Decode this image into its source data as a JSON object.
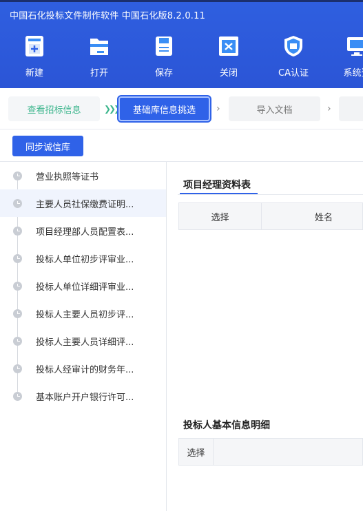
{
  "app": {
    "title": "中国石化投标文件制作软件 中国石化版8.2.0.11"
  },
  "toolbar": {
    "new": {
      "label": "新建",
      "icon": "new-file-icon"
    },
    "open": {
      "label": "打开",
      "icon": "open-folder-icon"
    },
    "save": {
      "label": "保存",
      "icon": "save-disk-icon"
    },
    "close": {
      "label": "关闭",
      "icon": "close-window-icon"
    },
    "ca": {
      "label": "CA认证",
      "icon": "shield-icon"
    },
    "system": {
      "label": "系统登",
      "icon": "monitor-icon"
    }
  },
  "steps": [
    {
      "label": "查看招标信息",
      "state": "done"
    },
    {
      "label": "基础库信息挑选",
      "state": "active"
    },
    {
      "label": "导入文档",
      "state": "pending"
    },
    {
      "label": "",
      "state": "pending"
    }
  ],
  "sync_button": "同步诚信库",
  "sidebar": {
    "items": [
      {
        "label": "营业执照等证书"
      },
      {
        "label": "主要人员社保缴费证明..."
      },
      {
        "label": "项目经理部人员配置表..."
      },
      {
        "label": "投标人单位初步评审业..."
      },
      {
        "label": "投标人单位详细评审业..."
      },
      {
        "label": "投标人主要人员初步评..."
      },
      {
        "label": "投标人主要人员详细评..."
      },
      {
        "label": "投标人经审计的财务年..."
      },
      {
        "label": "基本账户开户银行许可..."
      }
    ],
    "active_index": 1
  },
  "main": {
    "section1": {
      "title": "项目经理资料表",
      "columns": [
        "选择",
        "姓名"
      ]
    },
    "section2": {
      "title": "投标人基本信息明细",
      "columns": [
        "选择"
      ]
    }
  },
  "colors": {
    "primary": "#2f62e8",
    "header_bg": "#2b55d6",
    "done_step": "#3bb58c"
  }
}
